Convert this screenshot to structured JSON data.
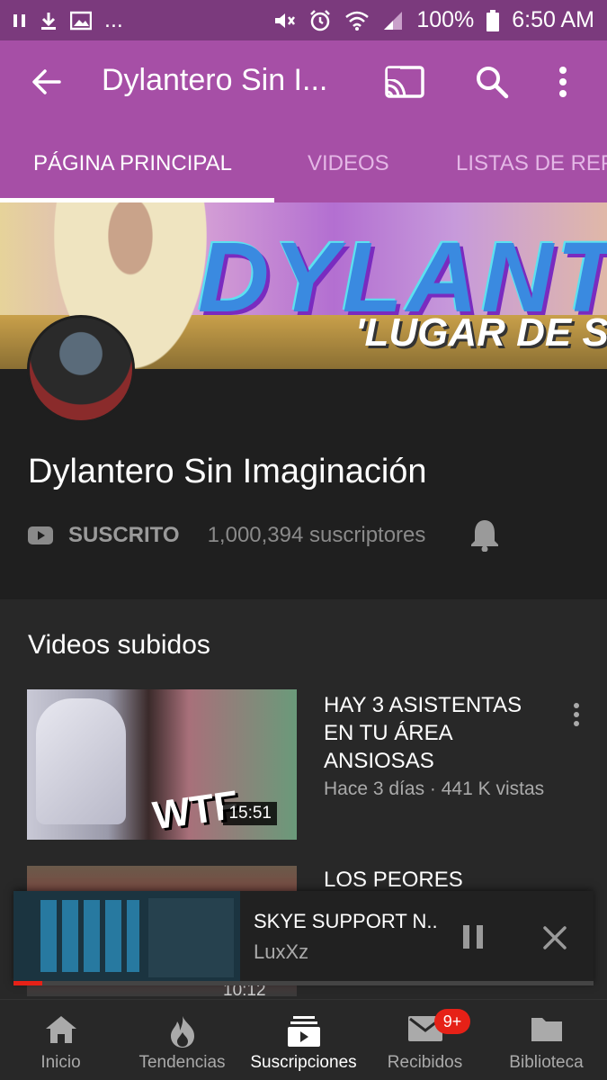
{
  "status_bar": {
    "battery": "100%",
    "time": "6:50 AM",
    "more": "..."
  },
  "app_bar": {
    "title": "Dylantero Sin I..."
  },
  "tabs": [
    {
      "label": "PÁGINA PRINCIPAL",
      "active": true
    },
    {
      "label": "VIDEOS",
      "active": false
    },
    {
      "label": "LISTAS DE REP",
      "active": false
    }
  ],
  "banner": {
    "logo_text": "DYLANTE",
    "subtitle_text": "'LUGAR DE SUI"
  },
  "channel": {
    "name": "Dylantero Sin Imaginación",
    "subscribe_status": "SUSCRITO",
    "subscriber_count": "1,000,394 suscriptores"
  },
  "section": {
    "title": "Videos subidos"
  },
  "videos": [
    {
      "title": "HAY 3 ASISTENTAS EN TU ÁREA ANSIOSAS",
      "meta": "Hace 3 días · 441 K vistas",
      "duration": "15:51",
      "thumb_text": "WTF"
    },
    {
      "title": "LOS PEORES",
      "duration": "10:12"
    }
  ],
  "mini_player": {
    "title": "SKYE SUPPORT N..",
    "channel": "LuxXz",
    "progress": 0.05
  },
  "bottom_nav": [
    {
      "label": "Inicio",
      "icon": "home-icon",
      "active": false
    },
    {
      "label": "Tendencias",
      "icon": "flame-icon",
      "active": false
    },
    {
      "label": "Suscripciones",
      "icon": "subscriptions-icon",
      "active": true
    },
    {
      "label": "Recibidos",
      "icon": "mail-icon",
      "active": false,
      "badge": "9+"
    },
    {
      "label": "Biblioteca",
      "icon": "folder-icon",
      "active": false
    }
  ],
  "colors": {
    "status_bar": "#7b3a7d",
    "app_bar": "#a64fa6",
    "background": "#1f1f1f",
    "accent_red": "#e62117"
  }
}
